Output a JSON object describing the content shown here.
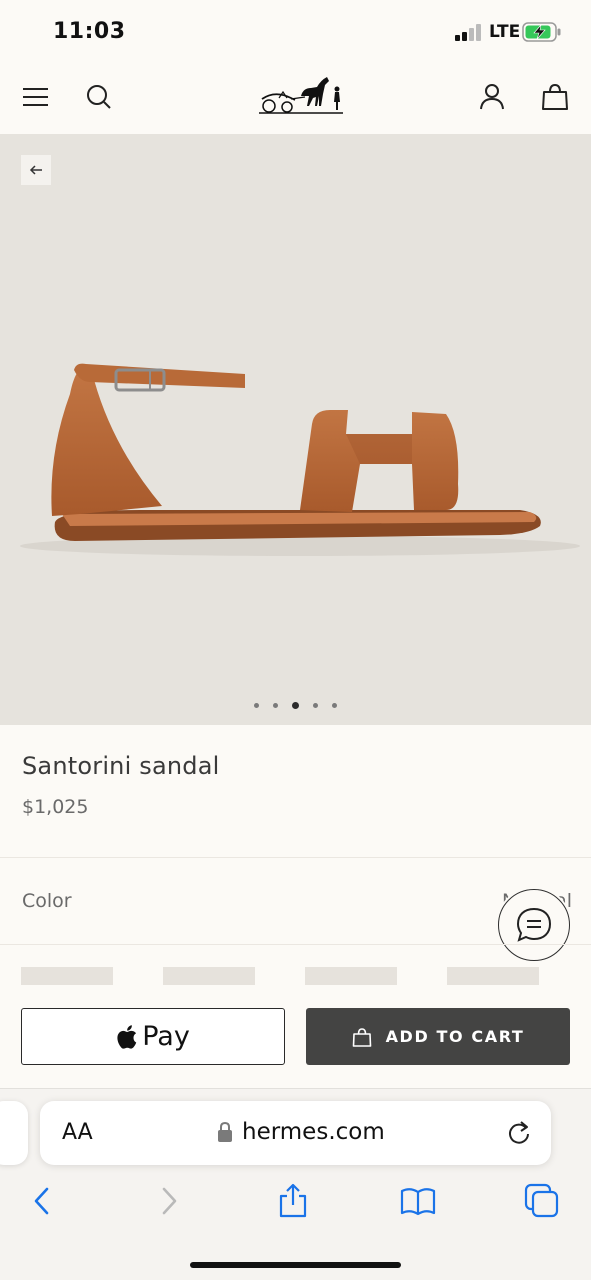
{
  "status_bar": {
    "time": "11:03",
    "network": "LTE"
  },
  "header": {
    "menu_icon": "hamburger-menu-icon",
    "search_icon": "search-icon",
    "logo": "hermes-carriage-logo",
    "account_icon": "user-icon",
    "bag_icon": "shopping-bag-icon"
  },
  "hero": {
    "image": "Santorini sandal product photo",
    "current_slide": 3,
    "slide_count": 5
  },
  "product": {
    "name": "Santorini sandal",
    "price": "$1,025",
    "color_label": "Color",
    "color_value": "Natural"
  },
  "actions": {
    "apple_pay_label": "Pay",
    "add_to_cart_label": "ADD TO CART"
  },
  "browser": {
    "aa_label": "AA",
    "url": "hermes.com"
  },
  "colors": {
    "background": "#fcfaf6",
    "hero_bg": "#e6e3dd",
    "cart_button": "#444443",
    "safari_blue": "#1a73e8",
    "leather": "#b8693a"
  }
}
